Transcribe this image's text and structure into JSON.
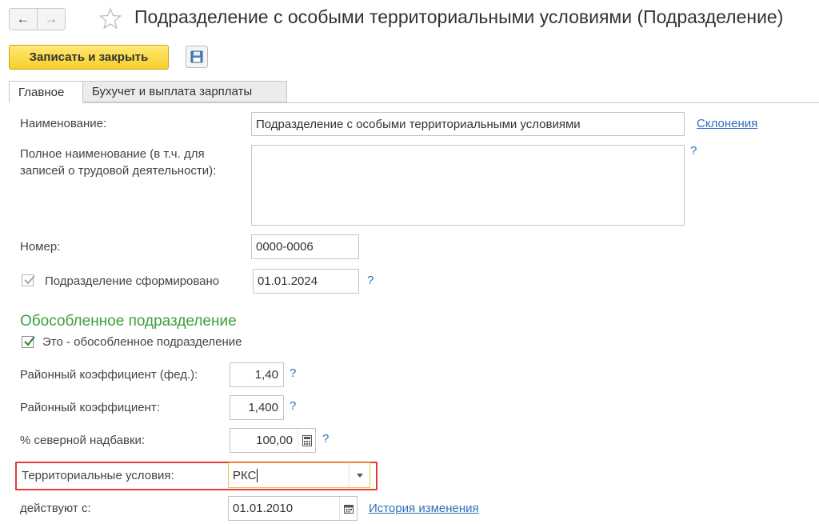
{
  "title": "Подразделение с особыми территориальными условиями (Подразделение)",
  "toolbar": {
    "save_close_label": "Записать и закрыть"
  },
  "tabs": [
    {
      "label": "Главное",
      "active": true
    },
    {
      "label": "Бухучет и выплата зарплаты",
      "active": false
    }
  ],
  "form": {
    "name": {
      "label": "Наименование:",
      "value": "Подразделение с особыми территориальными условиями",
      "link": "Склонения"
    },
    "full_name": {
      "label": "Полное наименование (в т.ч. для записей о трудовой деятельности):",
      "value": "",
      "help": "?"
    },
    "number": {
      "label": "Номер:",
      "value": "0000-0006"
    },
    "formed": {
      "label": "Подразделение сформировано",
      "checked": true,
      "value": "01.01.2024",
      "help": "?"
    },
    "separate_section": {
      "heading": "Обособленное подразделение",
      "checkbox_label": "Это - обособленное подразделение",
      "checked": true
    },
    "regional_coef_fed": {
      "label": "Районный коэффициент (фед.):",
      "value": "1,40",
      "help": "?"
    },
    "regional_coef": {
      "label": "Районный коэффициент:",
      "value": "1,400",
      "help": "?"
    },
    "north_bonus": {
      "label": "% северной надбавки:",
      "value": "100,00",
      "help": "?"
    },
    "territorial": {
      "label": "Территориальные условия:",
      "value": "РКС"
    },
    "effective_from": {
      "label": "действуют с:",
      "value": "01.01.2010",
      "link": "История изменения"
    }
  },
  "colors": {
    "accent_button": "#f7cf2a",
    "section_heading": "#3c9f3c",
    "link": "#2c6fbe",
    "highlight": "#e53935"
  }
}
